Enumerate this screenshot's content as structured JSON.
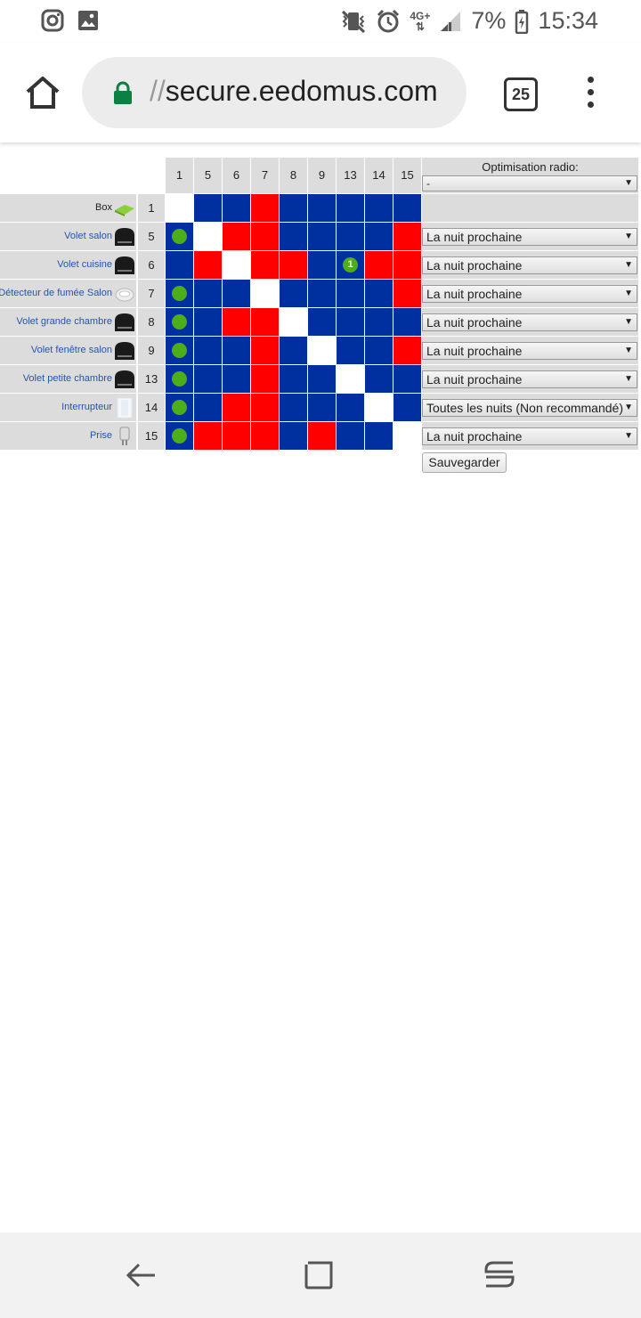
{
  "status_bar": {
    "battery": "7%",
    "time": "15:34",
    "network": "4G+"
  },
  "browser": {
    "url_prefix": "//",
    "url_host": "secure.eedomus.com",
    "tab_count": "25"
  },
  "table": {
    "column_ids": [
      "1",
      "5",
      "6",
      "7",
      "8",
      "9",
      "13",
      "14",
      "15"
    ],
    "optimisation_header": "Optimisation radio:",
    "box_select": "-",
    "save_label": "Sauvegarder",
    "rows": [
      {
        "label": "Box",
        "id": "1",
        "icon": "box-router-icon",
        "cells": [
          "w",
          "b",
          "b",
          "r",
          "b",
          "b",
          "b",
          "b",
          "b"
        ],
        "dots": [],
        "option": null
      },
      {
        "label": "Volet salon",
        "id": "5",
        "icon": "shutter-module-icon",
        "cells": [
          "b",
          "w",
          "r",
          "r",
          "b",
          "b",
          "b",
          "b",
          "r"
        ],
        "dots": [
          0
        ],
        "option": "La nuit prochaine"
      },
      {
        "label": "Volet cuisine",
        "id": "6",
        "icon": "shutter-module-icon",
        "cells": [
          "b",
          "r",
          "w",
          "r",
          "r",
          "b",
          "b",
          "r",
          "r"
        ],
        "dots": [],
        "numdot": {
          "col": 6,
          "text": "1"
        },
        "option": "La nuit prochaine"
      },
      {
        "label": "Détecteur de fumée Salon",
        "id": "7",
        "icon": "smoke-detector-icon",
        "cells": [
          "b",
          "b",
          "b",
          "w",
          "b",
          "b",
          "b",
          "b",
          "r"
        ],
        "dots": [
          0
        ],
        "option": "La nuit prochaine"
      },
      {
        "label": "Volet grande chambre",
        "id": "8",
        "icon": "shutter-module-icon",
        "cells": [
          "b",
          "b",
          "r",
          "r",
          "w",
          "b",
          "b",
          "b",
          "b"
        ],
        "dots": [
          0
        ],
        "option": "La nuit prochaine"
      },
      {
        "label": "Volet fenêtre salon",
        "id": "9",
        "icon": "shutter-module-icon",
        "cells": [
          "b",
          "b",
          "b",
          "r",
          "b",
          "w",
          "b",
          "b",
          "r"
        ],
        "dots": [
          0
        ],
        "option": "La nuit prochaine"
      },
      {
        "label": "Volet petite chambre",
        "id": "13",
        "icon": "shutter-module-icon",
        "cells": [
          "b",
          "b",
          "b",
          "r",
          "b",
          "b",
          "w",
          "b",
          "b"
        ],
        "dots": [
          0
        ],
        "option": "La nuit prochaine"
      },
      {
        "label": "Interrupteur",
        "id": "14",
        "icon": "wall-switch-icon",
        "cells": [
          "b",
          "b",
          "r",
          "r",
          "b",
          "b",
          "b",
          "w",
          "b"
        ],
        "dots": [
          0
        ],
        "option": "Toutes les nuits (Non recommandé)"
      },
      {
        "label": "Prise",
        "id": "15",
        "icon": "plug-icon",
        "cells": [
          "b",
          "r",
          "r",
          "r",
          "b",
          "r",
          "b",
          "b",
          "w"
        ],
        "dots": [
          0
        ],
        "option": "La nuit prochaine"
      }
    ]
  },
  "colors": {
    "blue": "#002f9f",
    "red": "#ff0000",
    "green_dot": "#4caf1a",
    "link": "#2456a8"
  }
}
